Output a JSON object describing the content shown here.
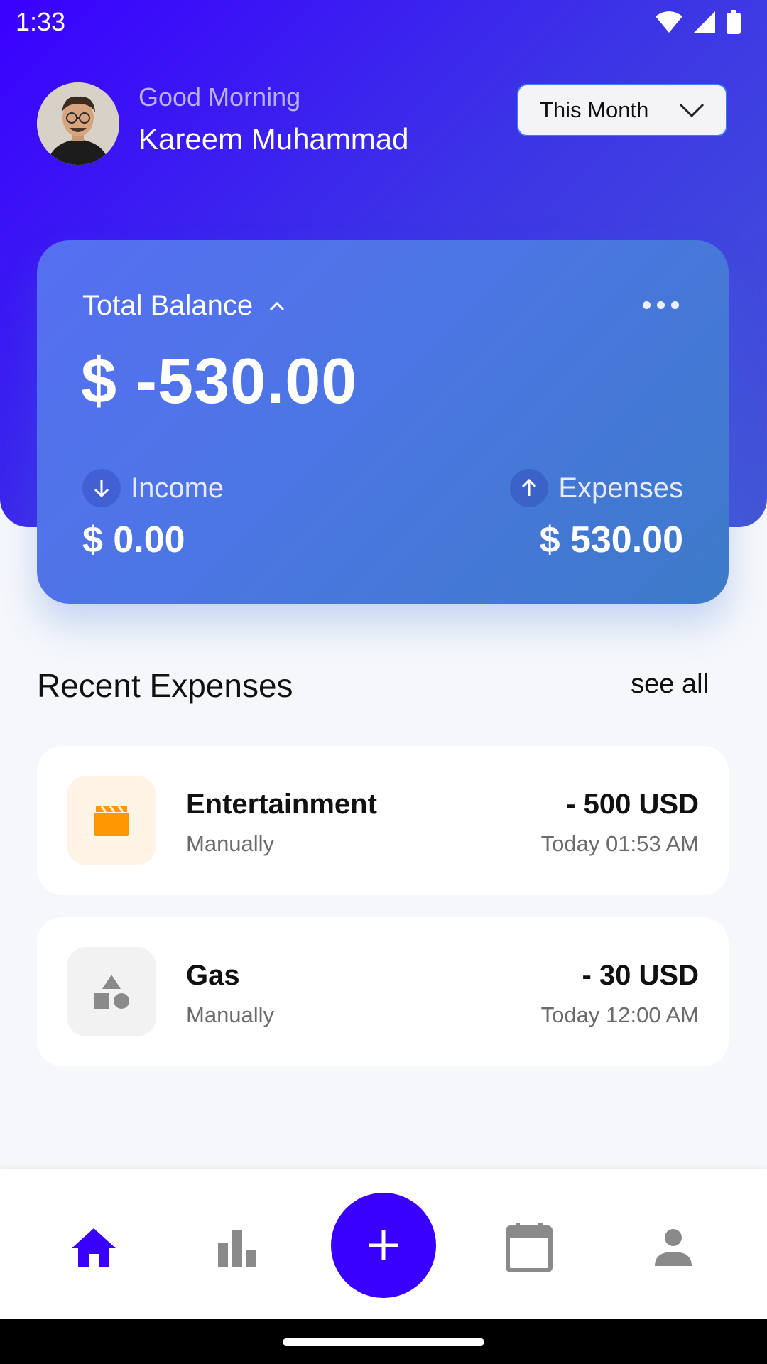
{
  "status_bar": {
    "time": "1:33"
  },
  "header": {
    "greeting": "Good Morning",
    "user_name": "Kareem Muhammad",
    "period_select": {
      "value": "This Month"
    }
  },
  "balance_card": {
    "label": "Total Balance",
    "amount": "$ -530.00",
    "income": {
      "label": "Income",
      "value": "$ 0.00"
    },
    "expenses": {
      "label": "Expenses",
      "value": "$ 530.00"
    }
  },
  "recent_expenses": {
    "title": "Recent Expenses",
    "see_all_label": "see all",
    "items": [
      {
        "category": "Entertainment",
        "method": "Manually",
        "amount": "- 500 USD",
        "time": "Today 01:53 AM",
        "icon": "clapperboard-icon",
        "icon_bg": "#fff4e6",
        "icon_color": "#ff9800"
      },
      {
        "category": "Gas",
        "method": "Manually",
        "amount": "- 30 USD",
        "time": "Today 12:00 AM",
        "icon": "shapes-icon",
        "icon_bg": "#f2f2f2",
        "icon_color": "#8a8a8a"
      }
    ]
  },
  "bottom_nav": {
    "items": [
      {
        "icon": "home-icon",
        "active": true
      },
      {
        "icon": "bar-chart-icon",
        "active": false
      },
      {
        "icon": "plus-icon",
        "active": false
      },
      {
        "icon": "calendar-icon",
        "active": false
      },
      {
        "icon": "person-icon",
        "active": false
      }
    ],
    "active_color": "#3a00ff",
    "inactive_color": "#8a8a8a"
  },
  "colors": {
    "brand": "#3a00ff",
    "card_gradient_start": "#566ff2",
    "card_gradient_end": "#3d7ac8"
  }
}
